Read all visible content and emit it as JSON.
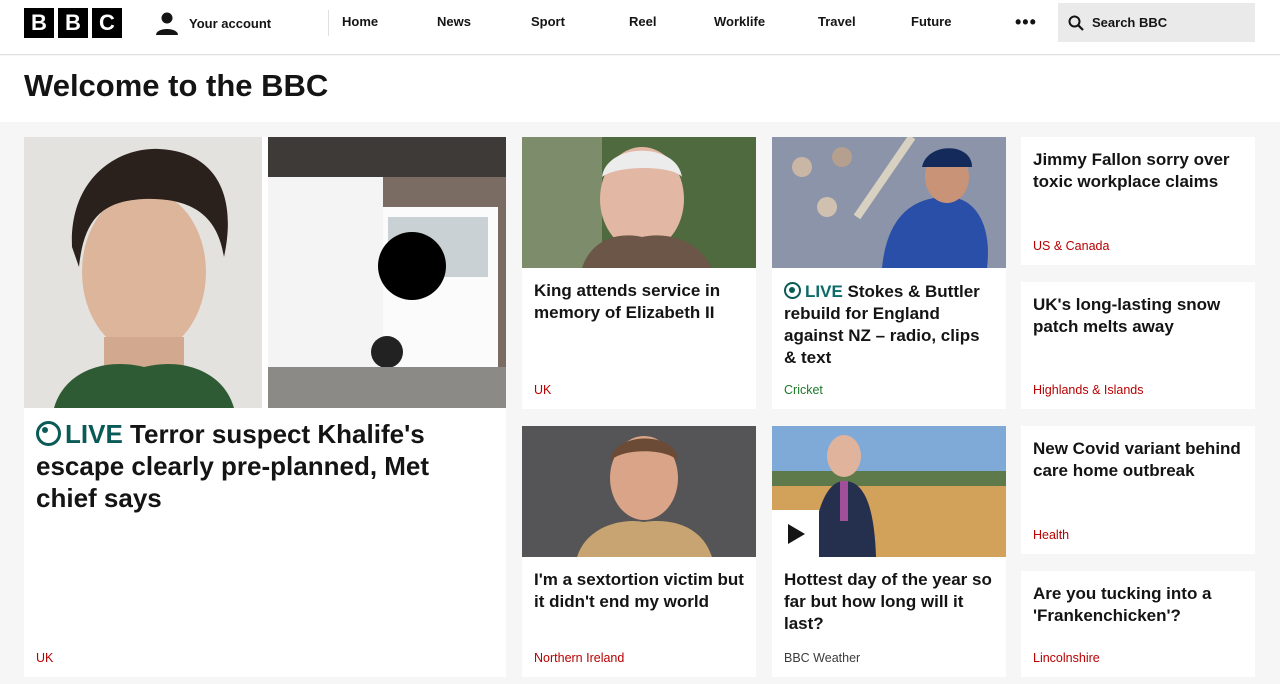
{
  "header": {
    "logo_letters": [
      "B",
      "B",
      "C"
    ],
    "account_label": "Your account",
    "nav": [
      "Home",
      "News",
      "Sport",
      "Reel",
      "Worklife",
      "Travel",
      "Future"
    ],
    "more_label": "•••",
    "search_placeholder": "Search BBC"
  },
  "page_title": "Welcome to the BBC",
  "lead": {
    "live_label": "LIVE",
    "title": "Terror suspect Khalife's escape clearly pre-planned, Met chief says",
    "tag": "UK"
  },
  "cards": [
    {
      "title": "King attends service in memory of Elizabeth II",
      "tag": "UK"
    },
    {
      "live_label": "LIVE",
      "title": "Stokes & Buttler rebuild for England against NZ – radio, clips & text",
      "tag": "Cricket"
    },
    {
      "title": "I'm a sextortion victim but it didn't end my world",
      "tag": "Northern Ireland"
    },
    {
      "title": "Hottest day of the year so far but how long will it last?",
      "tag": "BBC Weather"
    }
  ],
  "text_cards": [
    {
      "title": "Jimmy Fallon sorry over toxic workplace claims",
      "tag": "US & Canada"
    },
    {
      "title": "UK's long-lasting snow patch melts away",
      "tag": "Highlands & Islands"
    },
    {
      "title": "New Covid variant behind care home outbreak",
      "tag": "Health"
    },
    {
      "title": "Are you tucking into a 'Frankenchicken'?",
      "tag": "Lincolnshire"
    }
  ],
  "colors": {
    "live": "#0a5a57",
    "tag_news": "#b80000",
    "tag_sport": "#1d7a2a",
    "tag_weather": "#3c3c3c"
  }
}
